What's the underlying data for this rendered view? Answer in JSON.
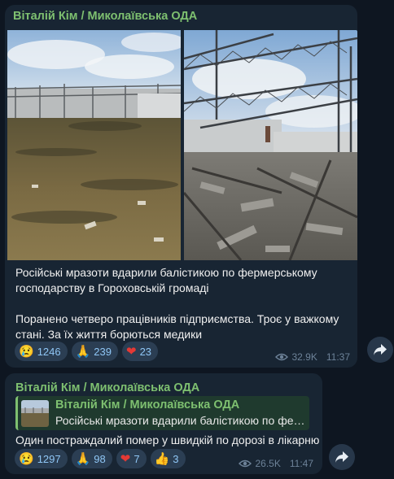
{
  "messages": [
    {
      "sender": "Віталій Кім / Миколаївська ОДА",
      "paragraphs": [
        "Російські мразоти вдарили балістикою по фермерському господарству в Гороховській громаді",
        "Поранено четверо працівників підприємства. Троє у важкому стані. За їх життя борються медики"
      ],
      "reactions": [
        {
          "emoji": "😢",
          "count": "1246"
        },
        {
          "emoji": "🙏",
          "count": "239"
        },
        {
          "emoji": "❤",
          "count": "23"
        }
      ],
      "views": "32.9K",
      "time": "11:37",
      "photos": [
        "damaged-farm-field",
        "collapsed-roof-structure"
      ]
    },
    {
      "sender": "Віталій Кім / Миколаївська ОДА",
      "reply": {
        "sender": "Віталій Кім / Миколаївська ОДА",
        "text": "Російські мразоти вдарили балістикою по ферм..."
      },
      "text": "Один постраждалий помер у швидкій по дорозі в лікарню",
      "reactions": [
        {
          "emoji": "😢",
          "count": "1297"
        },
        {
          "emoji": "🙏",
          "count": "98"
        },
        {
          "emoji": "❤",
          "count": "7"
        },
        {
          "emoji": "👍",
          "count": "3"
        }
      ],
      "views": "26.5K",
      "time": "11:47"
    }
  ],
  "colors": {
    "background": "#0e1621",
    "bubble": "#182533",
    "sender": "#7ec070",
    "meta": "#6d8298",
    "reaction": "#8fc6f5"
  },
  "icons": [
    "eye-icon",
    "forward-icon"
  ]
}
